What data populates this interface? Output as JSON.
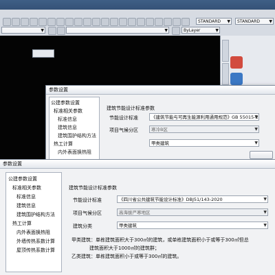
{
  "window_title": "",
  "menubar": {
    "items": [
      "",
      "",
      "",
      "",
      "",
      "",
      "",
      "",
      "",
      "",
      ""
    ]
  },
  "file_tab": "",
  "toolbar": {
    "standard_1": "STANDARD",
    "standard_2": "STANDARD",
    "layer_combo": "",
    "style_combo": "",
    "bylayer": "ByLayer"
  },
  "drawing": {
    "tab_label": "",
    "view_label": ""
  },
  "right_panel": {
    "tab_labels": [
      "",
      ""
    ],
    "items": [
      "",
      "",
      ""
    ]
  },
  "dialog1": {
    "title": "参数设置",
    "tree": [
      "公建参数设置",
      "标准相关参数",
      "标准信息",
      "建筑信息",
      "建筑围护结构方法",
      "热工计算",
      "内外表面换热阻"
    ],
    "section": "建筑节能设计标准参数",
    "rows": [
      {
        "label": "节能设计标准",
        "value": "《建筑节能与可再生能源利用通用规范》GB 55015-2021（试用）"
      },
      {
        "label": "项目气候分区",
        "value": "寒冷B区"
      },
      {
        "label": "",
        "value": "甲类建筑"
      }
    ],
    "button": ""
  },
  "dialog2": {
    "title": "参数设置",
    "tree": [
      {
        "label": "公建参数设置",
        "indent": 0
      },
      {
        "label": "标准相关参数",
        "indent": 1
      },
      {
        "label": "标准信息",
        "indent": 2
      },
      {
        "label": "建筑信息",
        "indent": 2
      },
      {
        "label": "建筑围护结构方法",
        "indent": 2
      },
      {
        "label": "热工计算",
        "indent": 1
      },
      {
        "label": "内外表面换热阻",
        "indent": 2
      },
      {
        "label": "外墙传热系数计算",
        "indent": 2
      },
      {
        "label": "屋顶传热系数计算",
        "indent": 2
      }
    ],
    "section": "建筑节能设计标准参数",
    "rows": [
      {
        "label": "节能设计标准",
        "value": "《四川省公共建筑节能设计标准》DBJ51/143-2020",
        "disabled": false
      },
      {
        "label": "项目气候分区",
        "value": "高海拔严寒地区",
        "disabled": true
      },
      {
        "label": "建筑分类",
        "value": "甲类建筑",
        "disabled": false
      }
    ],
    "notes": [
      "甲类建筑：单栋建筑面积大于300㎡的建筑，或单栋建筑面积小于或等于300㎡但总",
      "建筑面积大于1000㎡的建筑群；",
      "乙类建筑：单栋建筑面积小于或等于300㎡的建筑。"
    ]
  },
  "colors": {
    "menubar": "#3f5f86",
    "drawing_bg": "#040404",
    "dialog_bg": "#f0f1f3"
  }
}
